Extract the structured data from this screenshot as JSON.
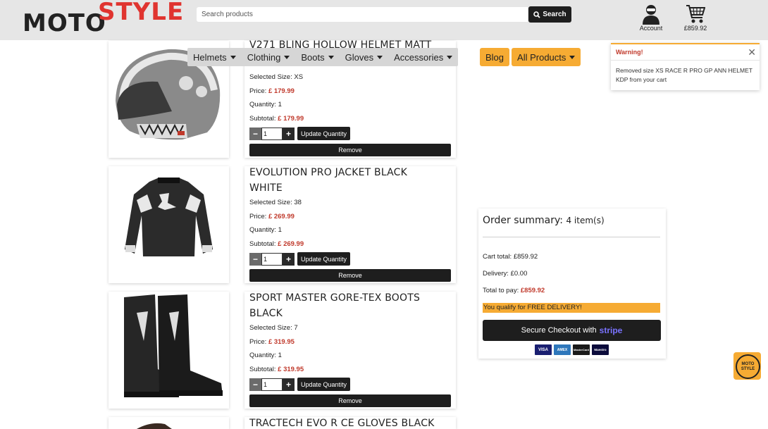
{
  "header": {
    "logo_part1": "MOTO",
    "logo_part2": "STYLE",
    "search_placeholder": "Search products",
    "search_button": "Search",
    "account_label": "Account",
    "cart_total": "£859.92"
  },
  "nav": {
    "items": [
      "Helmets",
      "Clothing",
      "Boots",
      "Gloves",
      "Accessories"
    ],
    "blog": "Blog",
    "all_products": "All Products"
  },
  "toast": {
    "title": "Warning!",
    "message": "Removed size XS RACE R PRO GP ANN HELMET KDP from your cart"
  },
  "cart_items": [
    {
      "title": "V271 BLING HOLLOW HELMET MATT",
      "size_label": "Selected Size:",
      "size": "XS",
      "price_label": "Price:",
      "price": "£ 179.99",
      "quantity_label": "Quantity:",
      "quantity": "1",
      "subtotal_label": "Subtotal:",
      "subtotal": "£ 179.99",
      "qty_value": "1"
    },
    {
      "title_line1": "EVOLUTION PRO JACKET BLACK",
      "title_line2": "WHITE",
      "size_label": "Selected Size:",
      "size": "38",
      "price_label": "Price:",
      "price": "£ 269.99",
      "quantity_label": "Quantity:",
      "quantity": "1",
      "subtotal_label": "Subtotal:",
      "subtotal": "£ 269.99",
      "qty_value": "1"
    },
    {
      "title_line1": "SPORT MASTER GORE-TEX BOOTS",
      "title_line2": "BLACK",
      "size_label": "Selected Size:",
      "size": "7",
      "price_label": "Price:",
      "price": "£ 319.95",
      "quantity_label": "Quantity:",
      "quantity": "1",
      "subtotal_label": "Subtotal:",
      "subtotal": "£ 319.95",
      "qty_value": "1"
    },
    {
      "title": "TRACTECH EVO R CE GLOVES BLACK"
    }
  ],
  "buttons": {
    "minus": "−",
    "plus": "+",
    "update_quantity": "Update Quantity",
    "remove": "Remove"
  },
  "summary": {
    "title": "Order summary:",
    "count": "4 item(s)",
    "cart_total": "Cart total: £859.92",
    "delivery": "Delivery: £0.00",
    "total_label": "Total to pay:",
    "total_value": "£859.92",
    "free_delivery": "You qualify for FREE DELIVERY!",
    "checkout_label": "Secure Checkout with",
    "checkout_brand": "stripe",
    "card_logos": [
      "VISA",
      "AMEX",
      "MasterCard",
      "Maestro"
    ]
  },
  "badge": {
    "line1": "MOTO",
    "line2": "STYLE"
  },
  "colors": {
    "accent": "#f6ab33",
    "brand_red": "#e0342f",
    "price_red": "#c0392b",
    "dark": "#1e1e1e"
  }
}
